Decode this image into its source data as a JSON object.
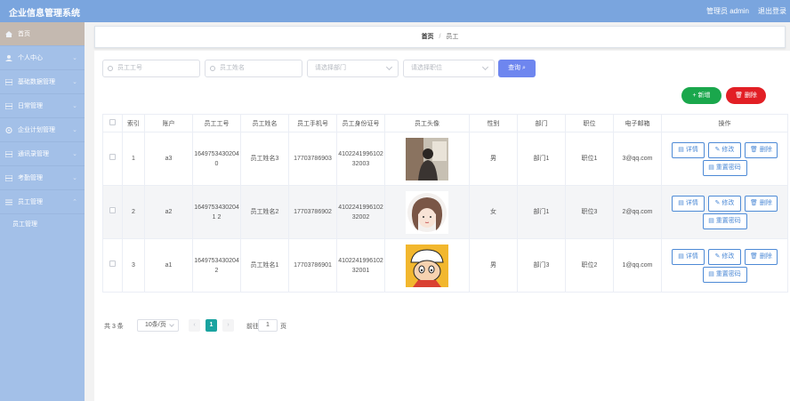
{
  "header": {
    "title": "企业信息管理系统",
    "user": "管理员 admin",
    "logout": "退出登录"
  },
  "sidebar": {
    "items": [
      {
        "label": "首页",
        "icon": "home-icon"
      },
      {
        "label": "个人中心",
        "icon": "user-icon"
      },
      {
        "label": "基础数据管理",
        "icon": "grid-icon"
      },
      {
        "label": "日常管理",
        "icon": "grid-icon"
      },
      {
        "label": "企业计划管理",
        "icon": "gear-icon"
      },
      {
        "label": "通讯录管理",
        "icon": "grid-icon"
      },
      {
        "label": "考勤管理",
        "icon": "grid-icon"
      },
      {
        "label": "员工管理",
        "icon": "menu-icon"
      }
    ],
    "sub_item": "员工管理"
  },
  "breadcrumb": {
    "home": "首页",
    "separator": "/",
    "current": "员工"
  },
  "search": {
    "emp_no_placeholder": "员工工号",
    "emp_name_placeholder": "员工姓名",
    "dept_placeholder": "请选择部门",
    "position_placeholder": "请选择职位",
    "query_label": "查询"
  },
  "actions": {
    "add_label": "+ 新增",
    "delete_label": "删除"
  },
  "table": {
    "headers": [
      "索引",
      "账户",
      "员工工号",
      "员工姓名",
      "员工手机号",
      "员工身份证号",
      "员工头像",
      "性别",
      "部门",
      "职位",
      "电子邮箱",
      "操作"
    ],
    "rows": [
      {
        "index": "1",
        "account": "a3",
        "emp_no": "16497534302040",
        "name": "员工姓名3",
        "phone": "17703786903",
        "id_card": "410224199610232003",
        "gender": "男",
        "dept": "部门1",
        "position": "职位1",
        "email": "3@qq.com",
        "avatar": "photo-avatar"
      },
      {
        "index": "2",
        "account": "a2",
        "emp_no": "16497534302041 2",
        "name": "员工姓名2",
        "phone": "17703786902",
        "id_card": "410224199610232002",
        "gender": "女",
        "dept": "部门1",
        "position": "职位3",
        "email": "2@qq.com",
        "avatar": "cartoon-girl-avatar"
      },
      {
        "index": "3",
        "account": "a1",
        "emp_no": "16497534302042",
        "name": "员工姓名1",
        "phone": "17703786901",
        "id_card": "410224199610232001",
        "gender": "男",
        "dept": "部门3",
        "position": "职位2",
        "email": "1@qq.com",
        "avatar": "cartoon-boy-avatar"
      }
    ],
    "ops": {
      "detail": "详情",
      "edit": "修改",
      "delete": "删除",
      "reset": "重置密码"
    }
  },
  "pagination": {
    "total": "共 3 条",
    "page_size": "10条/页",
    "prev": "‹",
    "current": "1",
    "next": "›",
    "goto": "前往",
    "goto_value": "1",
    "unit": "页"
  },
  "colors": {
    "topbar": "#7aa5de",
    "sidebar": "#a3c0e8",
    "active": "#c4b9b0",
    "add": "#1aa74c",
    "delete": "#e21f25",
    "query": "#6e86ef",
    "page_current": "#1aa3a0"
  }
}
